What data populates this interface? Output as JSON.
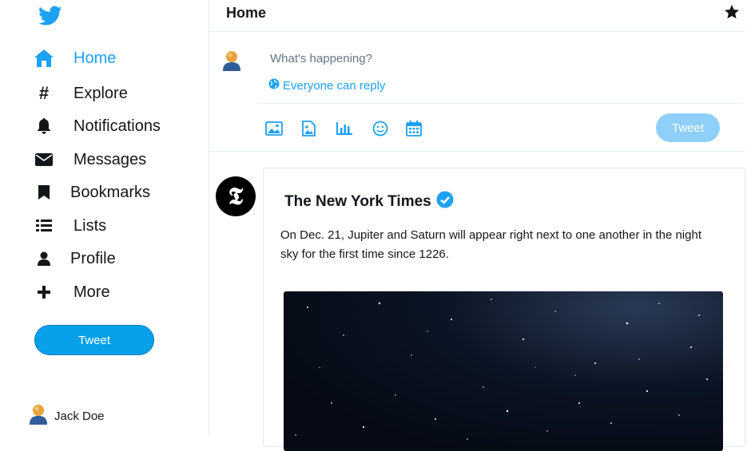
{
  "sidebar": {
    "items": [
      {
        "label": "Home",
        "icon": "home-icon"
      },
      {
        "label": "Explore",
        "icon": "hashtag-icon"
      },
      {
        "label": "Notifications",
        "icon": "bell-icon"
      },
      {
        "label": "Messages",
        "icon": "envelope-icon"
      },
      {
        "label": "Bookmarks",
        "icon": "bookmark-icon"
      },
      {
        "label": "Lists",
        "icon": "list-icon"
      },
      {
        "label": "Profile",
        "icon": "user-icon"
      },
      {
        "label": "More",
        "icon": "plus-icon"
      }
    ],
    "tweet_label": "Tweet",
    "user_name": "Jack Doe"
  },
  "header": {
    "title": "Home"
  },
  "compose": {
    "placeholder": "What's happening?",
    "reply_label": "Everyone can reply",
    "tweet_label": "Tweet"
  },
  "post": {
    "author": "The New York Times",
    "text": "On Dec. 21, Jupiter and Saturn will appear right next to one another in the night sky for the first time since 1226."
  },
  "colors": {
    "accent": "#1da1f2",
    "tweet_button": "#08a0e9",
    "tweet_button_disabled": "#8ed0f9"
  }
}
